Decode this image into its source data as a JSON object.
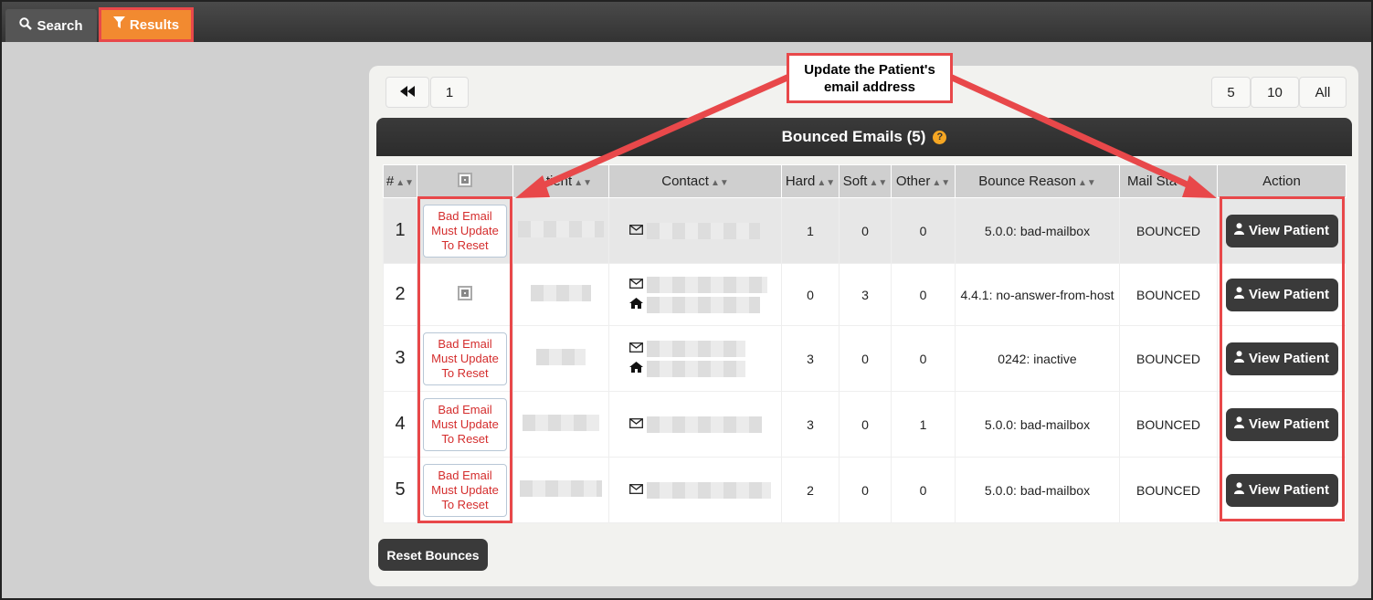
{
  "tabs": {
    "search_label": "Search",
    "results_label": "Results"
  },
  "pager": {
    "first_icon": "double-chevron-left-icon",
    "page": "1",
    "sizes": [
      "5",
      "10",
      "All"
    ]
  },
  "title": "Bounced Emails (5)",
  "help_glyph": "?",
  "columns": [
    "#",
    "",
    "Patient",
    "Contact",
    "Hard",
    "Soft",
    "Other",
    "Bounce Reason",
    "Mail Status",
    "Action"
  ],
  "column_labels": {
    "num": "#",
    "patient": "tient",
    "contact": "Contact",
    "hard": "Hard",
    "soft": "Soft",
    "other": "Other",
    "reason": "Bounce Reason",
    "status": "Mail Sta",
    "action": "Action"
  },
  "rows": [
    {
      "num": "1",
      "bad": [
        "Bad Email",
        "Must Update",
        "To Reset"
      ],
      "hard": "1",
      "soft": "0",
      "other": "0",
      "reason": "5.0.0: bad-mailbox",
      "status": "BOUNCED",
      "action": "View Patient"
    },
    {
      "num": "2",
      "bad": null,
      "hard": "0",
      "soft": "3",
      "other": "0",
      "reason": "4.4.1: no-answer-from-host",
      "status": "BOUNCED",
      "action": "View Patient"
    },
    {
      "num": "3",
      "bad": [
        "Bad Email",
        "Must Update",
        "To Reset"
      ],
      "hard": "3",
      "soft": "0",
      "other": "0",
      "reason": "0242: inactive",
      "status": "BOUNCED",
      "action": "View Patient"
    },
    {
      "num": "4",
      "bad": [
        "Bad Email",
        "Must Update",
        "To Reset"
      ],
      "hard": "3",
      "soft": "0",
      "other": "1",
      "reason": "5.0.0: bad-mailbox",
      "status": "BOUNCED",
      "action": "View Patient"
    },
    {
      "num": "5",
      "bad": [
        "Bad Email",
        "Must Update",
        "To Reset"
      ],
      "hard": "2",
      "soft": "0",
      "other": "0",
      "reason": "5.0.0: bad-mailbox",
      "status": "BOUNCED",
      "action": "View Patient"
    }
  ],
  "reset_label": "Reset Bounces",
  "callout": [
    "Update the Patient's",
    "email address"
  ],
  "colors": {
    "accent": "#f28a30",
    "highlight": "#e8484a",
    "bad_text": "#d42d2d",
    "dark_button": "#3a3a3a"
  }
}
